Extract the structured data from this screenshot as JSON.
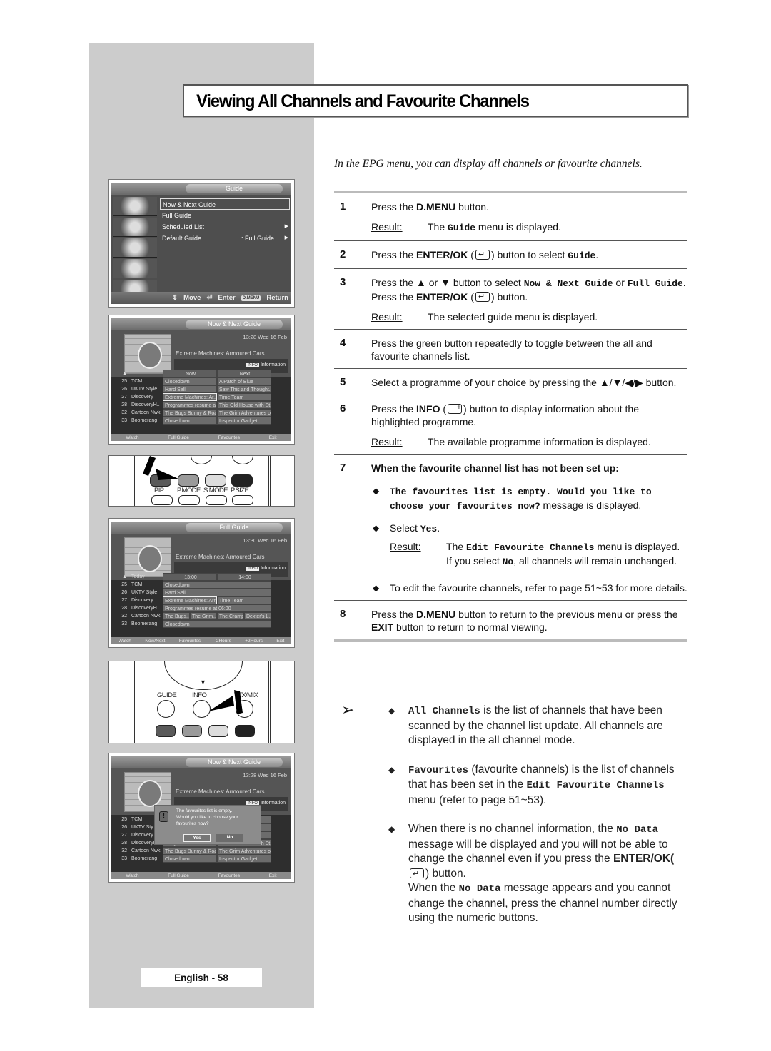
{
  "page": {
    "title": "Viewing All Channels and Favourite Channels",
    "intro": "In the EPG menu, you can display all channels or favourite channels.",
    "footer": "English - 58"
  },
  "steps": [
    {
      "num": "1",
      "parts": [
        "Press the ",
        "D.MENU",
        " button."
      ],
      "result_label": "Result:",
      "result": [
        "The ",
        "Guide",
        " menu is displayed."
      ]
    },
    {
      "num": "2",
      "parts": [
        "Press the ",
        "ENTER/OK",
        " (",
        ") button to select ",
        "Guide",
        "."
      ]
    },
    {
      "num": "3",
      "parts": [
        "Press the ▲ or ▼ button to select ",
        "Now & Next Guide",
        " or ",
        "Full Guide",
        ". Press the ",
        "ENTER/OK",
        " (",
        ") button."
      ],
      "result_label": "Result:",
      "result": [
        "The selected guide menu is displayed."
      ]
    },
    {
      "num": "4",
      "text": "Press the green button repeatedly to toggle between the all and favourite channels list."
    },
    {
      "num": "5",
      "text": "Select a programme of your choice by pressing the ▲/▼/◀/▶ button."
    },
    {
      "num": "6",
      "parts": [
        "Press the ",
        "INFO",
        " (",
        ") button to display information about the highlighted programme."
      ],
      "result_label": "Result:",
      "result": [
        "The available programme information is displayed."
      ]
    },
    {
      "num": "7",
      "heading": "When the favourite channel list has not been set up:",
      "bullets": [
        {
          "mono": "The favourites list is empty. Would you like to choose your favourites now?",
          "text": " message is displayed."
        },
        {
          "pre": "Select ",
          "mono": "Yes",
          "post": ".",
          "result_label": "Result:",
          "result_pre": "The ",
          "result_mono": "Edit Favourite Channels",
          "result_mid": " menu is displayed. If you select ",
          "result_mono2": "No",
          "result_post": ", all channels will remain unchanged."
        },
        {
          "text": "To edit the favourite channels, refer to page 51~53 for more details."
        }
      ]
    },
    {
      "num": "8",
      "parts": [
        "Press the ",
        "D.MENU",
        " button to return to the previous menu or press the ",
        "EXIT",
        " button to return to normal viewing."
      ]
    }
  ],
  "notes": [
    {
      "mono": "All Channels",
      "text": " is the list of channels that have been scanned by the channel list update. All channels are displayed in the all channel mode."
    },
    {
      "mono": "Favourites",
      "text": " (favourite channels) is the list of channels that has been set in the ",
      "mono2": "Edit Favourite Channels",
      "text2": " menu (refer to page 51~53)."
    },
    {
      "pre": "When there is no channel information, the ",
      "mono": "No Data",
      "text": " message will be displayed and you will not be able to change the channel even if you press the ",
      "bold": "ENTER/OK(",
      "text2": ") button.",
      "line2_pre": "When the ",
      "line2_mono": "No Data",
      "line2_text": " message appears and you cannot change the channel, press the channel number directly using the numeric buttons."
    }
  ],
  "guide_menu": {
    "title": "Guide",
    "items": [
      {
        "label": "Now & Next Guide",
        "value": "",
        "arrow": ""
      },
      {
        "label": "Full Guide",
        "value": "",
        "arrow": ""
      },
      {
        "label": "Scheduled List",
        "value": "",
        "arrow": "▶"
      },
      {
        "label": "Default Guide",
        "value": ": Full Guide",
        "arrow": "▶"
      }
    ],
    "footer": {
      "move": "Move",
      "enter": "Enter",
      "dmenu_key": "D.MENU",
      "return": "Return"
    }
  },
  "now_next": {
    "title": "Now & Next Guide",
    "time": "13:28 Wed 16 Feb",
    "programme": "Extreme Machines: Armoured Cars",
    "info_key": "INFO",
    "info_label": "Information",
    "columns": [
      "Now",
      "Next"
    ],
    "rows": [
      {
        "num": "25",
        "name": "TCM",
        "now": "Closedown",
        "next": "A Patch of Blue"
      },
      {
        "num": "26",
        "name": "UKTV Style",
        "now": "Hard Sell",
        "next": "Saw This and Thought.."
      },
      {
        "num": "27",
        "name": "Discovery",
        "now": "Extreme Machines: Ar..",
        "next": "Time Team"
      },
      {
        "num": "28",
        "name": "DiscoveryH..",
        "now": "Programmes resume at..",
        "next": "This Old House with St.."
      },
      {
        "num": "32",
        "name": "Cartoon Nwk",
        "now": "The Bugs Bunny & Roa..",
        "next": "The Grim Adventures o.."
      },
      {
        "num": "33",
        "name": "Boomerang",
        "now": "Closedown",
        "next": "Inspector Gadget"
      }
    ],
    "footer": [
      "Watch",
      "Full Guide",
      "Favourites",
      "Exit"
    ]
  },
  "full_guide": {
    "title": "Full Guide",
    "time": "13:30 Wed 16 Feb",
    "programme": "Extreme Machines: Armoured Cars",
    "info_key": "INFO",
    "info_label": "Information",
    "day": "Today",
    "columns": [
      "13:00",
      "14:00"
    ],
    "rows": [
      {
        "num": "25",
        "name": "TCM",
        "cells": [
          "Closedown"
        ]
      },
      {
        "num": "26",
        "name": "UKTV Style",
        "cells": [
          "Hard Sell"
        ]
      },
      {
        "num": "27",
        "name": "Discovery",
        "cells": [
          "Extreme Machines: Arm..",
          "Time Team"
        ]
      },
      {
        "num": "28",
        "name": "DiscoveryH..",
        "cells": [
          "Programmes resume at 06:00"
        ]
      },
      {
        "num": "32",
        "name": "Cartoon Nwk",
        "cells": [
          "The Bugs..",
          "The Grim..",
          "The Cramp..",
          "Dexter's L.."
        ]
      },
      {
        "num": "33",
        "name": "Boomerang",
        "cells": [
          "Closedown"
        ]
      }
    ],
    "footer": [
      "Watch",
      "Now/Next",
      "Favourites",
      "-2Hours",
      "+2Hours",
      "Exit"
    ]
  },
  "popup_screen": {
    "title": "Now & Next Guide",
    "time": "13:28 Wed 16 Feb",
    "programme": "Extreme Machines: Armoured Cars",
    "info_key": "INFO",
    "info_label": "Information",
    "popup": {
      "lines": [
        "The favourites list is empty.",
        "Would you like to choose your",
        "favourites now?"
      ],
      "yes": "Yes",
      "no": "No"
    },
    "rows": [
      {
        "num": "25",
        "name": "TCM",
        "now": "",
        "next": ""
      },
      {
        "num": "26",
        "name": "UKTV Sty..",
        "now": "",
        "next": "..ght.."
      },
      {
        "num": "27",
        "name": "Discovery",
        "now": "",
        "next": ""
      },
      {
        "num": "28",
        "name": "DiscoveryH..",
        "now": "Programmes resume at..",
        "next": "This Old House with St.."
      },
      {
        "num": "32",
        "name": "Cartoon Nwk",
        "now": "The Bugs Bunny & Roa..",
        "next": "The Grim Adventures o.."
      },
      {
        "num": "33",
        "name": "Boomerang",
        "now": "Closedown",
        "next": "Inspector Gadget"
      }
    ],
    "footer": [
      "Watch",
      "Full Guide",
      "Favourites",
      "Exit"
    ]
  },
  "remote1": {
    "labels": [
      "PIP",
      "P.MODE",
      "S.MODE",
      "P.SIZE"
    ],
    "colors": [
      "#5a5a5a",
      "#9a9a9a",
      "#dddddd",
      "#222222"
    ]
  },
  "remote2": {
    "labels": [
      "GUIDE",
      "INFO",
      "TTX/MIX"
    ],
    "colors": [
      "#5a5a5a",
      "#9a9a9a",
      "#dddddd",
      "#222222"
    ]
  }
}
